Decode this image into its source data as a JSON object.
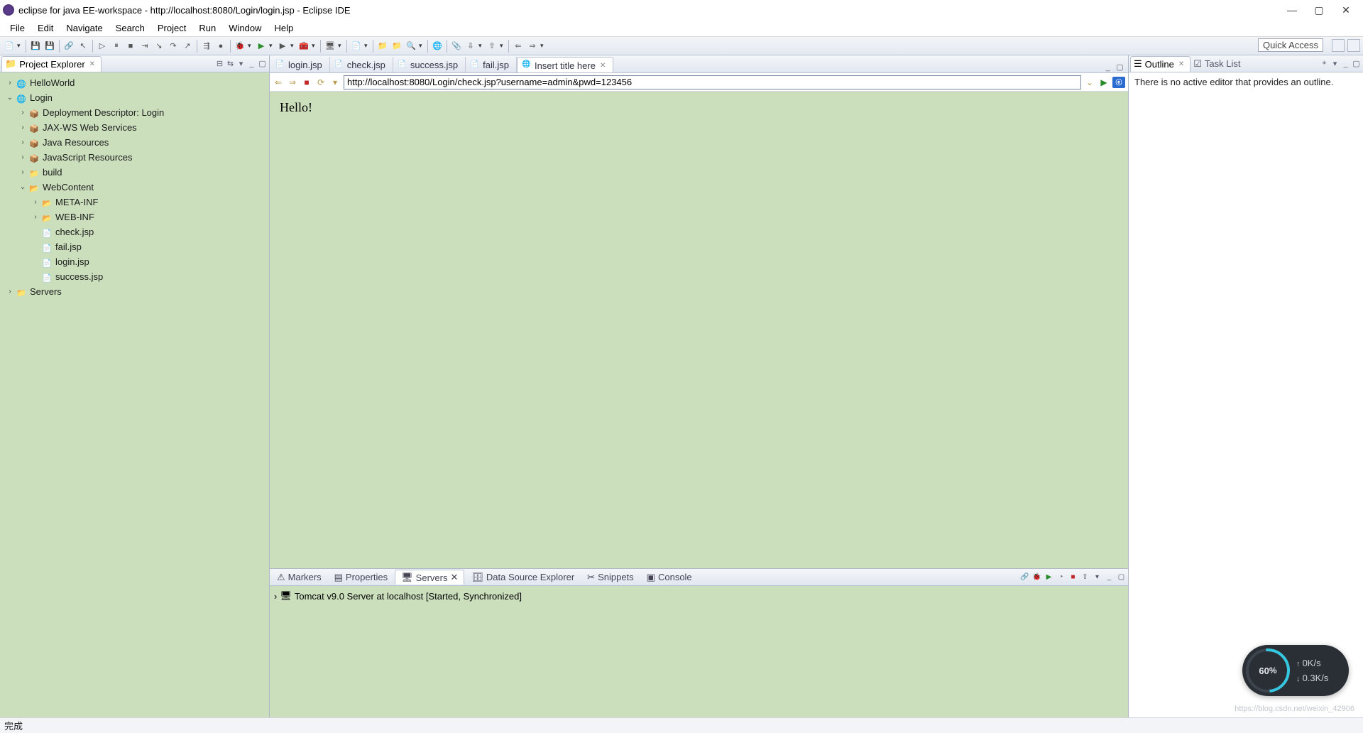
{
  "title": "eclipse for java EE-workspace - http://localhost:8080/Login/login.jsp - Eclipse IDE",
  "menus": [
    "File",
    "Edit",
    "Navigate",
    "Search",
    "Project",
    "Run",
    "Window",
    "Help"
  ],
  "quickAccess": "Quick Access",
  "projectExplorer": {
    "title": "Project Explorer",
    "tree": [
      {
        "indent": 0,
        "chev": ">",
        "icon": "proj",
        "label": "HelloWorld"
      },
      {
        "indent": 0,
        "chev": "v",
        "icon": "proj",
        "label": "Login"
      },
      {
        "indent": 1,
        "chev": ">",
        "icon": "jar",
        "label": "Deployment Descriptor: Login"
      },
      {
        "indent": 1,
        "chev": ">",
        "icon": "jar",
        "label": "JAX-WS Web Services"
      },
      {
        "indent": 1,
        "chev": ">",
        "icon": "jar",
        "label": "Java Resources"
      },
      {
        "indent": 1,
        "chev": ">",
        "icon": "jar",
        "label": "JavaScript Resources"
      },
      {
        "indent": 1,
        "chev": ">",
        "icon": "closed",
        "label": "build"
      },
      {
        "indent": 1,
        "chev": "v",
        "icon": "open",
        "label": "WebContent"
      },
      {
        "indent": 2,
        "chev": ">",
        "icon": "open",
        "label": "META-INF"
      },
      {
        "indent": 2,
        "chev": ">",
        "icon": "open",
        "label": "WEB-INF"
      },
      {
        "indent": 2,
        "chev": "",
        "icon": "file",
        "label": "check.jsp"
      },
      {
        "indent": 2,
        "chev": "",
        "icon": "file",
        "label": "fail.jsp"
      },
      {
        "indent": 2,
        "chev": "",
        "icon": "file",
        "label": "login.jsp"
      },
      {
        "indent": 2,
        "chev": "",
        "icon": "file",
        "label": "success.jsp"
      },
      {
        "indent": 0,
        "chev": ">",
        "icon": "closed",
        "label": "Servers"
      }
    ]
  },
  "editorTabs": [
    {
      "label": "login.jsp",
      "active": false
    },
    {
      "label": "check.jsp",
      "active": false
    },
    {
      "label": "success.jsp",
      "active": false
    },
    {
      "label": "fail.jsp",
      "active": false
    },
    {
      "label": "Insert title here",
      "active": true
    }
  ],
  "addressBar": "http://localhost:8080/Login/check.jsp?username=admin&pwd=123456",
  "pageContent": "Hello!",
  "outline": {
    "title": "Outline",
    "taskList": "Task List",
    "msg": "There is no active editor that provides an outline."
  },
  "bottomTabs": [
    "Markers",
    "Properties",
    "Servers",
    "Data Source Explorer",
    "Snippets",
    "Console"
  ],
  "bottomActive": "Servers",
  "serversRow": "Tomcat v9.0 Server at localhost  [Started, Synchronized]",
  "gauge": {
    "pct": "60",
    "unit": "%",
    "up": "0K/s",
    "down": "0.3K/s"
  },
  "status": "完成",
  "watermark": "https://blog.csdn.net/weixin_42906"
}
